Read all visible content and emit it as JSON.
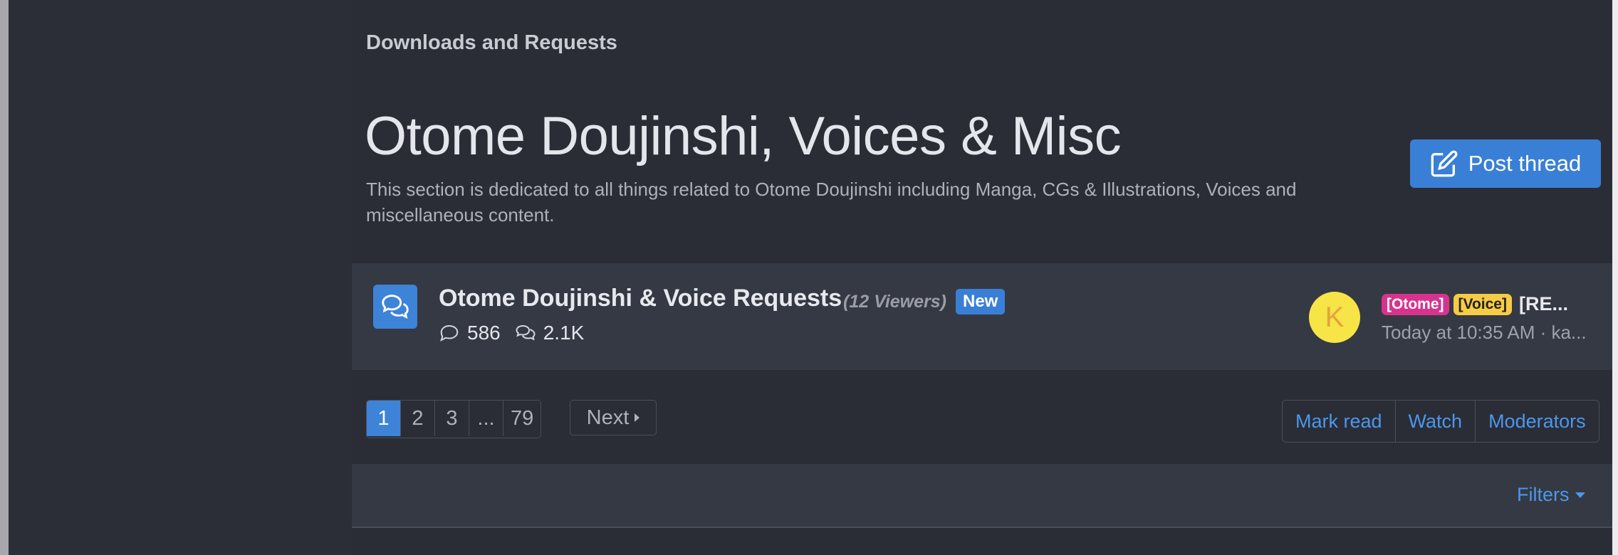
{
  "breadcrumb": "Downloads and Requests",
  "page_title": "Otome Doujinshi, Voices & Misc",
  "description": "This section is dedicated to all things related to Otome Doujinshi including Manga, CGs & Illustrations, Voices and miscellaneous content.",
  "post_thread_label": "Post thread",
  "node": {
    "title": "Otome Doujinshi & Voice Requests",
    "viewers": "(12 Viewers)",
    "badge": "New",
    "threads": "586",
    "messages": "2.1K",
    "latest": {
      "avatar_letter": "K",
      "prefix1": "[Otome]",
      "prefix2": "[Voice]",
      "title": "[RE...",
      "meta": "Today at 10:35 AM · ka..."
    }
  },
  "pagination": {
    "pages": [
      "1",
      "2",
      "3",
      "...",
      "79"
    ],
    "current": "1",
    "next_label": "Next"
  },
  "actions": {
    "mark_read": "Mark read",
    "watch": "Watch",
    "moderators": "Moderators"
  },
  "filters_label": "Filters",
  "colors": {
    "accent": "#3a7fd6",
    "link": "#4c97ec",
    "prefix_otome": "#d7338e",
    "prefix_voice": "#f6cc44",
    "avatar_bg": "#f7e447"
  }
}
